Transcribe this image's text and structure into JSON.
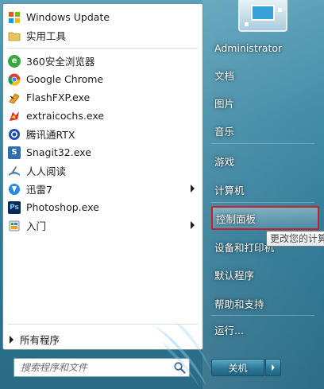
{
  "pinned": [
    {
      "label": "Windows Update",
      "icon": "windows-update-icon"
    },
    {
      "label": "实用工具",
      "icon": "folder-icon"
    }
  ],
  "recent": [
    {
      "label": "360安全浏览器",
      "icon": "360-browser-icon",
      "submenu": false
    },
    {
      "label": "Google Chrome",
      "icon": "chrome-icon",
      "submenu": false
    },
    {
      "label": "FlashFXP.exe",
      "icon": "flashfxp-icon",
      "submenu": false
    },
    {
      "label": "extraicochs.exe",
      "icon": "extraico-icon",
      "submenu": false
    },
    {
      "label": "腾讯通RTX",
      "icon": "rtx-icon",
      "submenu": false
    },
    {
      "label": "Snagit32.exe",
      "icon": "snagit-icon",
      "submenu": false
    },
    {
      "label": "人人阅读",
      "icon": "renren-reader-icon",
      "submenu": false
    },
    {
      "label": "迅雷7",
      "icon": "xunlei-icon",
      "submenu": true
    },
    {
      "label": "Photoshop.exe",
      "icon": "photoshop-icon",
      "submenu": false
    },
    {
      "label": "入门",
      "icon": "getting-started-icon",
      "submenu": true
    }
  ],
  "all_programs": "所有程序",
  "search": {
    "placeholder": "搜索程序和文件"
  },
  "right": {
    "user": "Administrator",
    "documents": "文档",
    "pictures": "图片",
    "music": "音乐",
    "games": "游戏",
    "computer": "计算机",
    "control_panel": "控制面板",
    "devices": "设备和打印机",
    "default_programs": "默认程序",
    "help": "帮助和支持",
    "run": "运行..."
  },
  "tooltip": "更改您的计算",
  "shutdown": "关机",
  "colors": {
    "highlight_border": "#c8202a",
    "accent": "#2f7a96"
  }
}
